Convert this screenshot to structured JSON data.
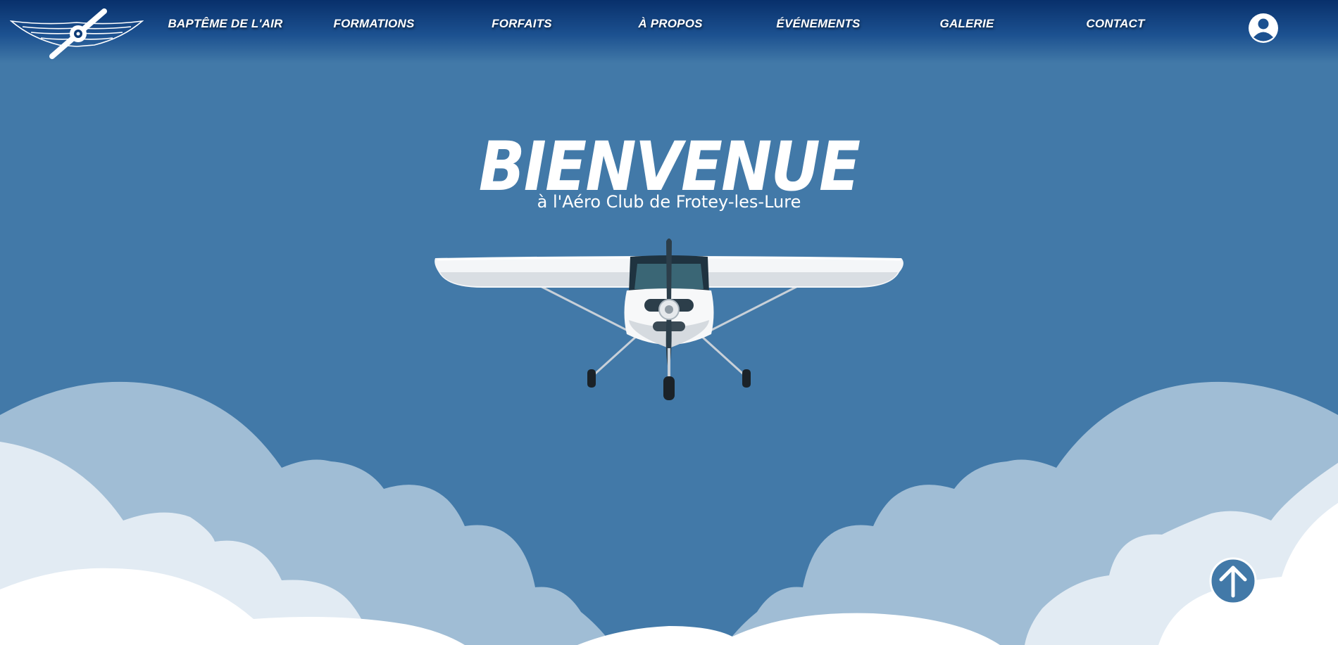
{
  "header": {
    "nav": [
      {
        "label": "BAPTÊME DE L'AIR"
      },
      {
        "label": "FORMATIONS"
      },
      {
        "label": "FORFAITS"
      },
      {
        "label": "À PROPOS"
      },
      {
        "label": "ÉVÉNEMENTS"
      },
      {
        "label": "GALERIE"
      },
      {
        "label": "CONTACT"
      }
    ]
  },
  "hero": {
    "title": "BIENVENUE",
    "subtitle": "à l'Aéro Club de Frotey-les-Lure"
  },
  "icons": {
    "logo": "propeller-wings-logo",
    "user": "user-account-icon",
    "scroll_top": "arrow-up-icon",
    "illustration": "airplane-illustration"
  },
  "colors": {
    "sky": "#4279a8",
    "header_dark": "#08306b",
    "cloud_back": "#a0bdd5",
    "cloud_mid": "#e2ebf3",
    "cloud_front": "#ffffff",
    "accent_button": "#4279a8"
  }
}
